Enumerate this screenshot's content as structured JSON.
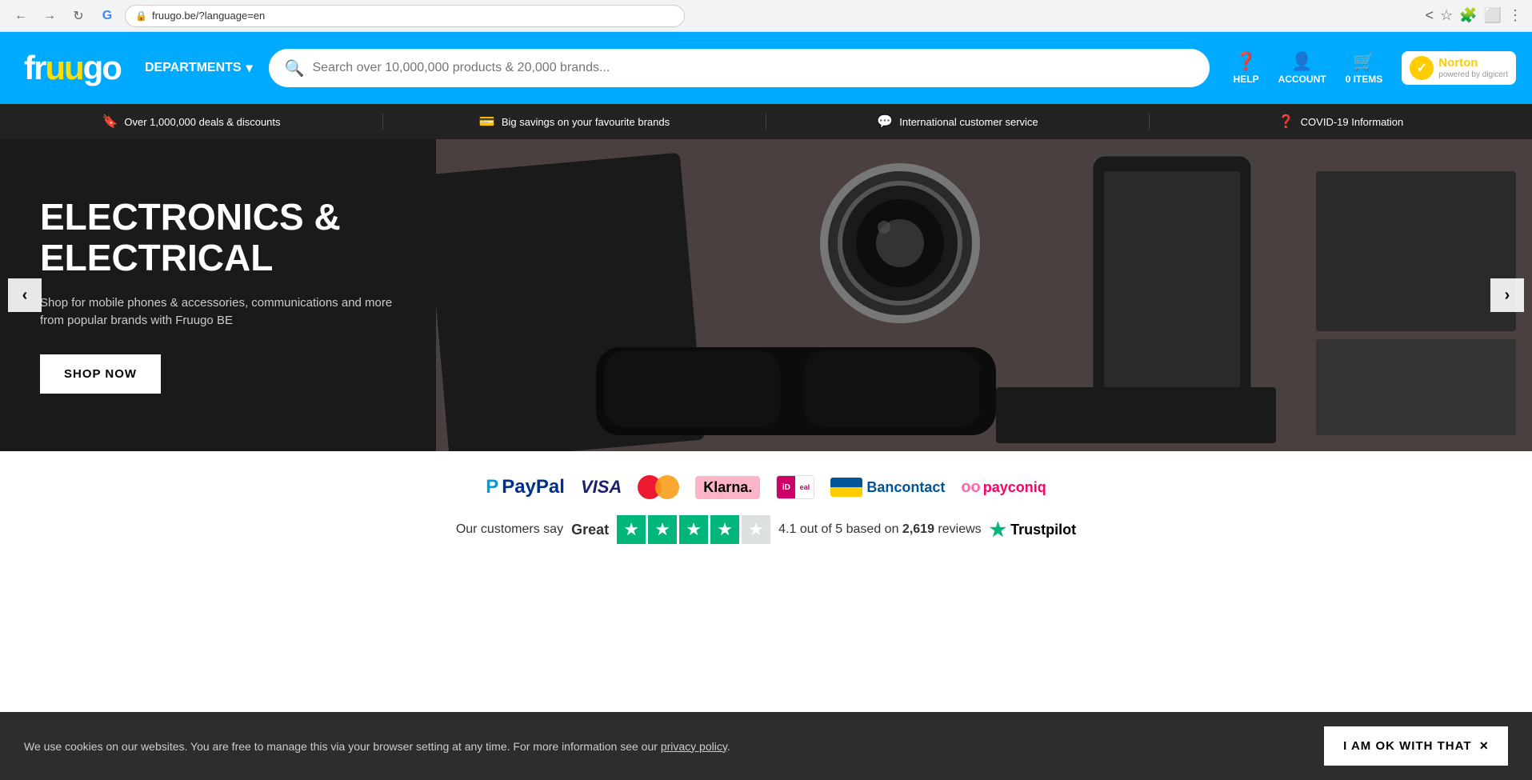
{
  "browser": {
    "url": "fruugo.be/?language=en",
    "nav": {
      "back": "‹",
      "forward": "›",
      "refresh": "↻",
      "google": "G"
    }
  },
  "header": {
    "logo_text": "fruugo",
    "departments_label": "DEPARTMENTS",
    "search_placeholder": "Search over 10,000,000 products & 20,000 brands...",
    "help_label": "HELP",
    "account_label": "ACCOUNT",
    "cart_label": "0 ITEMS",
    "norton_label": "Norton",
    "norton_sub": "powered by digicert"
  },
  "info_bar": {
    "item1": "Over 1,000,000 deals & discounts",
    "item2": "Big savings on your favourite brands",
    "item3": "International customer service",
    "item4": "COVID-19 Information"
  },
  "hero": {
    "title": "ELECTRONICS & ELECTRICAL",
    "description": "Shop for mobile phones & accessories, communications and more from popular brands with Fruugo BE",
    "cta_label": "SHOP NOW"
  },
  "payments": {
    "labels": [
      "PayPal",
      "VISA",
      "",
      "Klarna.",
      "",
      "Bancontact",
      "oo payconiq"
    ]
  },
  "trustpilot": {
    "prefix": "Our customers say",
    "rating_word": "Great",
    "rating": "4.1",
    "rating_suffix": "out of 5 based on",
    "review_count": "2,619",
    "review_suffix": "reviews",
    "brand": "Trustpilot"
  },
  "cookie": {
    "text": "We use cookies on our websites. You are free to manage this via your browser setting at any time. For more information see our",
    "link_text": "privacy policy",
    "ok_label": "I AM OK WITH THAT",
    "close_label": "×"
  }
}
